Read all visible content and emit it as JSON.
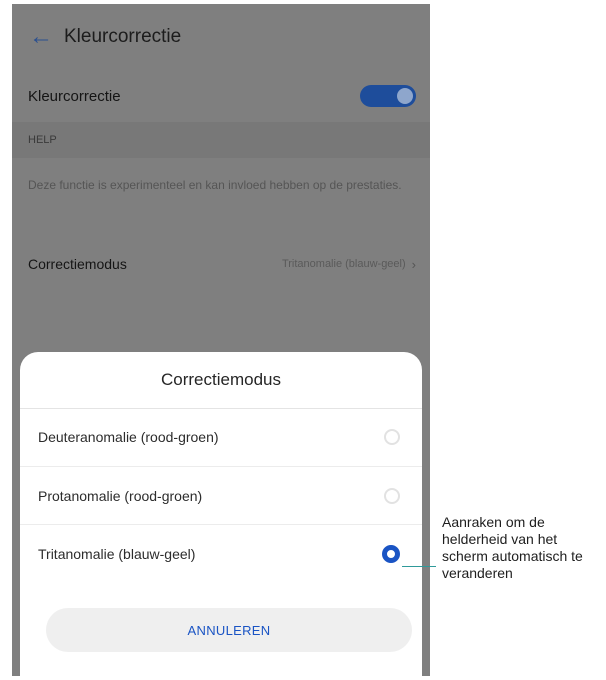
{
  "appbar": {
    "back_icon": "arrow-left-icon",
    "title": "Kleurcorrectie"
  },
  "settings": {
    "toggle_label": "Kleurcorrectie",
    "toggle_on": true,
    "section_header": "HELP",
    "help_text": "Deze functie is experimenteel en kan invloed hebben op de prestaties.",
    "mode_label": "Correctiemodus",
    "mode_value": "Tritanomalie (blauw-geel)"
  },
  "dialog": {
    "title": "Correctiemodus",
    "options": [
      {
        "label": "Deuteranomalie (rood-groen)",
        "selected": false
      },
      {
        "label": "Protanomalie (rood-groen)",
        "selected": false
      },
      {
        "label": "Tritanomalie (blauw-geel)",
        "selected": true
      }
    ],
    "cancel_label": "ANNULEREN"
  },
  "callout": {
    "text": "Aanraken om de helderheid van het scherm automatisch te veranderen"
  },
  "colors": {
    "accent": "#1a54c4",
    "callout_line": "#2f9a9a",
    "dim_overlay": "#7f7f7f"
  }
}
